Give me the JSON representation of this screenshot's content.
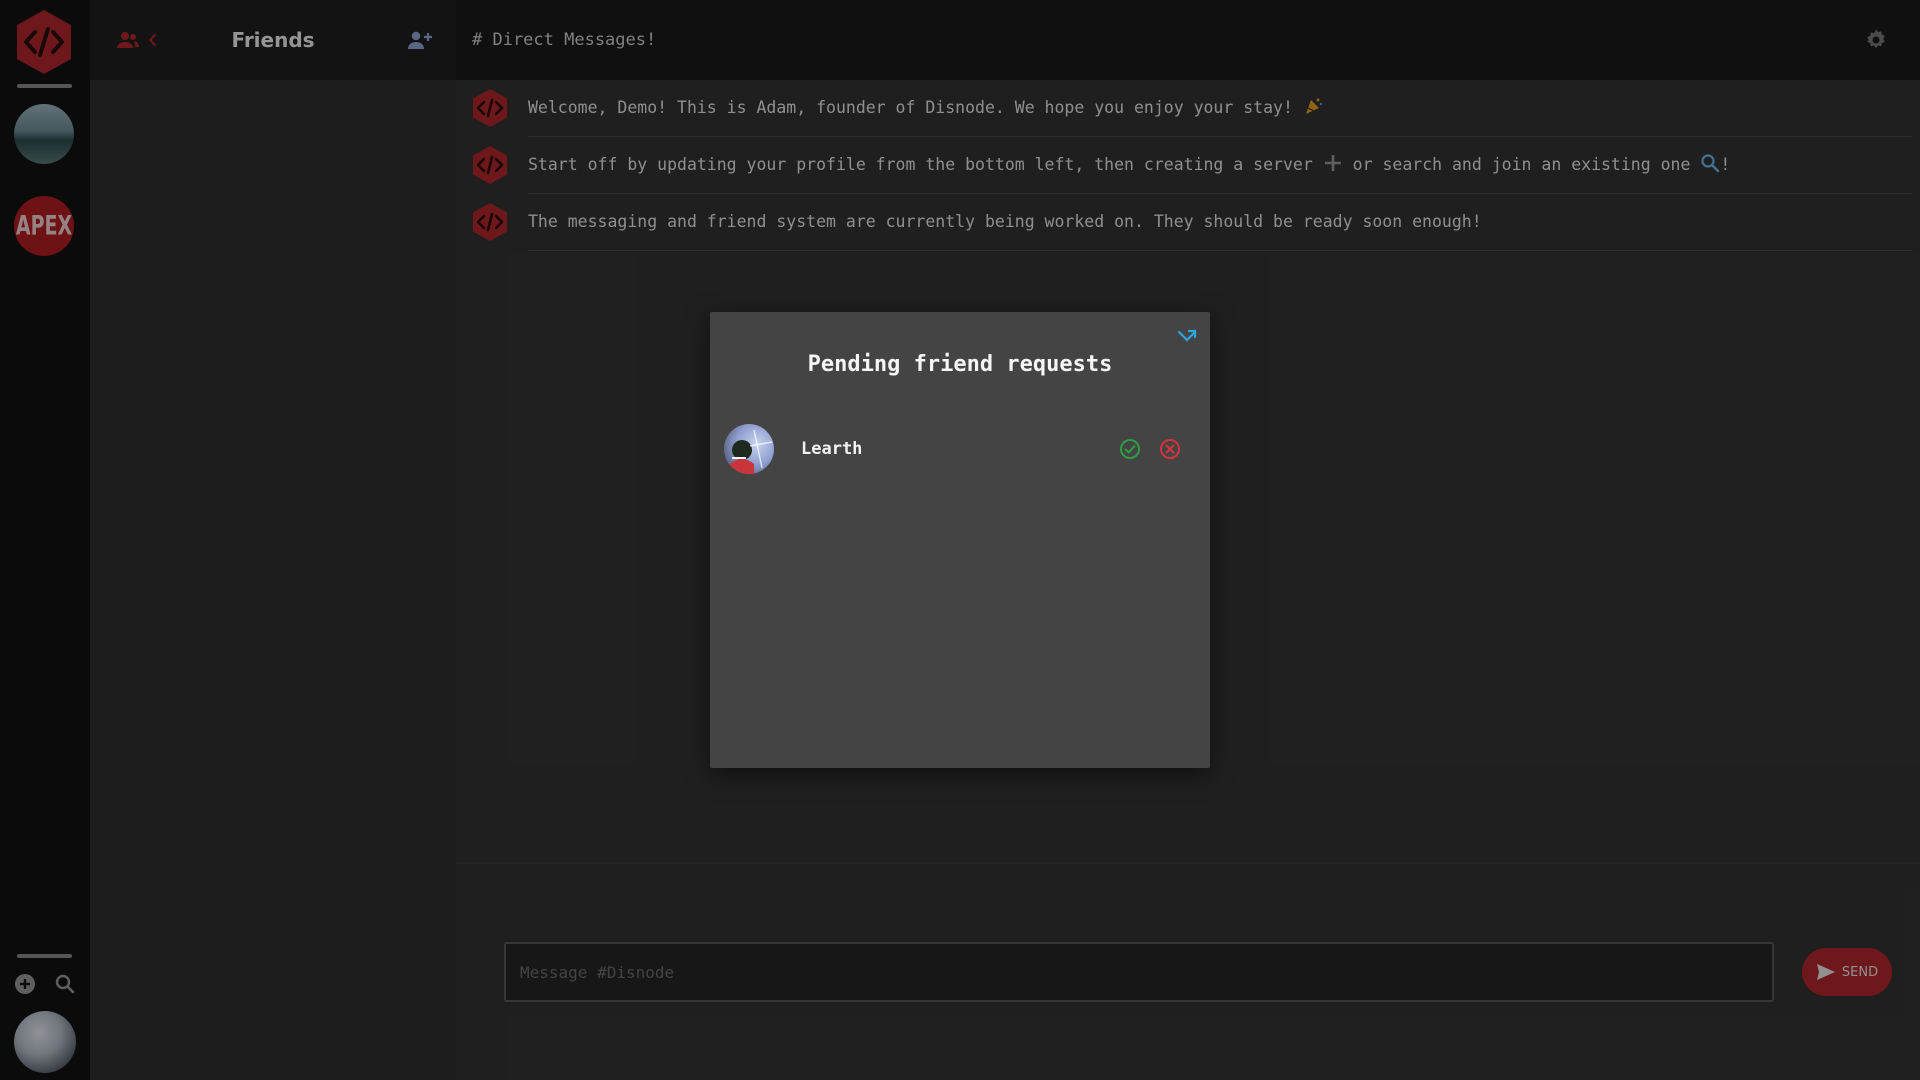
{
  "colors": {
    "accent": "#b3272c",
    "accept": "#2f9e44",
    "decline": "#d6333a",
    "close": "#2aa6e0"
  },
  "rail": {
    "logo_icon": "code-hexagon-icon",
    "servers": [
      {
        "name": "landscape-server"
      },
      {
        "name": "apex-server",
        "label": "APEX"
      }
    ],
    "tools": {
      "add_icon": "plus-circle-icon",
      "search_icon": "search-icon"
    }
  },
  "friends_panel": {
    "title": "Friends",
    "toggle_icons": [
      "users-icon",
      "chevron-left-icon"
    ],
    "add_friend_icon": "user-plus-icon"
  },
  "main": {
    "channel_title": "# Direct Messages!",
    "settings_icon": "gear-icon",
    "messages": [
      {
        "text": "Welcome, Demo! This is Adam, founder of Disnode. We hope you enjoy your stay!",
        "suffix_icon": "party-icon"
      },
      {
        "text_a": "Start off by updating your profile from the bottom left, then creating a server",
        "icon_a": "plus-icon",
        "text_b": "or search and join an existing one",
        "icon_b": "search-icon",
        "text_c": "!"
      },
      {
        "text": "The messaging and friend system are currently being worked on. They should be ready soon enough!"
      }
    ],
    "composer": {
      "placeholder": "Message #Disnode",
      "send_label": "SEND",
      "send_icon": "send-icon"
    }
  },
  "modal": {
    "title": "Pending friend requests",
    "close_icon": "collapse-arrow-icon",
    "requests": [
      {
        "name": "Learth",
        "accept_icon": "check-circle-icon",
        "decline_icon": "x-circle-icon"
      }
    ]
  }
}
